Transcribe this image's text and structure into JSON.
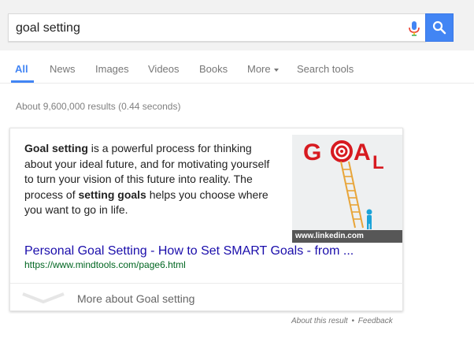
{
  "search": {
    "query": "goal setting"
  },
  "tabs": [
    {
      "label": "All"
    },
    {
      "label": "News"
    },
    {
      "label": "Images"
    },
    {
      "label": "Videos"
    },
    {
      "label": "Books"
    },
    {
      "label": "More"
    },
    {
      "label": "Search tools"
    }
  ],
  "stats": "About 9,600,000 results (0.44 seconds)",
  "card": {
    "snippet": [
      {
        "text": "Goal setting",
        "bold": true
      },
      {
        "text": " is a powerful process for thinking about your ideal future, and for motivating yourself to turn your vision of this future into reality. The process of ",
        "bold": false
      },
      {
        "text": "setting goals",
        "bold": true
      },
      {
        "text": " helps you choose where you want to go in life.",
        "bold": false
      }
    ],
    "image_credit": "www.linkedin.com",
    "image_word": "GOAL",
    "result_title": "Personal Goal Setting - How to Set SMART Goals - from ...",
    "result_url": "https://www.mindtools.com/page6.html",
    "more_label": "More about Goal setting"
  },
  "footer": {
    "about": "About this result",
    "separator": "•",
    "feedback": "Feedback"
  },
  "colors": {
    "accent": "#4285f4",
    "link": "#1a0dab",
    "url": "#006621"
  }
}
